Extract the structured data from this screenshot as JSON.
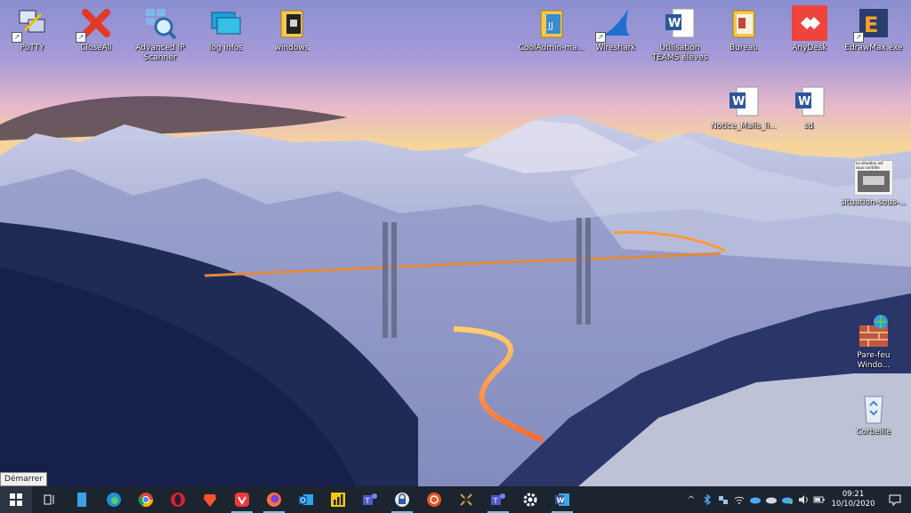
{
  "desktop": {
    "icons": [
      {
        "label": "PuTTY",
        "icon": "putty-icon"
      },
      {
        "label": "CloseAll",
        "icon": "closeall-icon"
      },
      {
        "label": "Advanced IP Scanner",
        "icon": "network-scanner-icon"
      },
      {
        "label": "log infos",
        "icon": "monitor-icon"
      },
      {
        "label": "windows",
        "icon": "folder-icon"
      },
      {
        "label": "CoolAdmin-ma...",
        "icon": "folder-icon"
      },
      {
        "label": "Wireshark",
        "icon": "wireshark-fin-icon"
      },
      {
        "label": "Utilisation TEAMS élèves",
        "icon": "word-icon"
      },
      {
        "label": "Bureau",
        "icon": "folder-icon"
      },
      {
        "label": "AnyDesk",
        "icon": "anydesk-icon"
      },
      {
        "label": "EdrawMax.exe",
        "icon": "edraw-icon"
      },
      {
        "label": "Notice_Mails_li...",
        "icon": "word-icon"
      },
      {
        "label": "sdl",
        "icon": "word-icon"
      },
      {
        "label": "situation-sous-...",
        "icon": "image-thumbnail-icon"
      },
      {
        "label": "Pare-feu Windo...",
        "icon": "firewall-icon"
      },
      {
        "label": "Corbeille",
        "icon": "recycle-bin-icon"
      }
    ],
    "thumbnail_caption": "La situation est sous contrôle"
  },
  "tooltip": {
    "text": "Démarrer"
  },
  "taskbar": {
    "apps": [
      "task-view-icon",
      "file-app-icon",
      "edge-icon",
      "chrome-icon",
      "opera-icon",
      "brave-icon",
      "vivaldi-icon",
      "firefox-icon",
      "outlook-icon",
      "powerbi-icon",
      "teams-icon",
      "keepass-icon",
      "ubuntu-icon",
      "crossed-tool-icon",
      "teams-icon",
      "settings-gear-icon",
      "word-icon"
    ],
    "tray_chevron": "^",
    "time": "09:21",
    "date": "10/10/2020"
  }
}
